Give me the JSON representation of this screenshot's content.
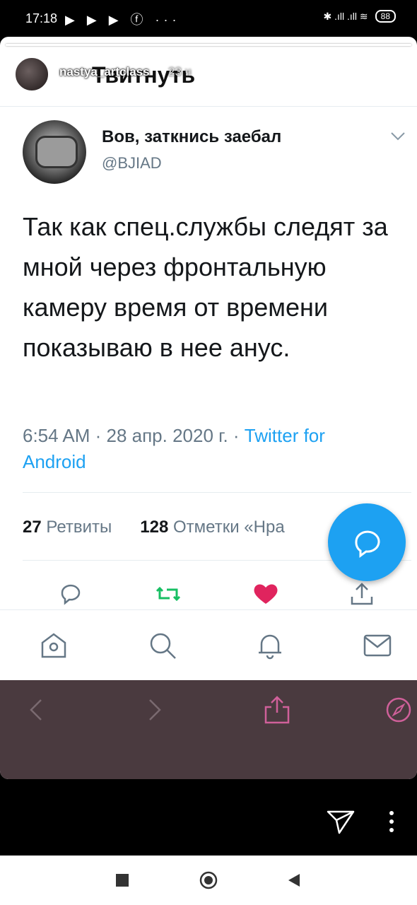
{
  "status_bar": {
    "time": "17:18",
    "left_icons": "▶ ▶ ▶ ⓕ ···",
    "signal": "✱ .ıll .ıll ≋",
    "battery": "88"
  },
  "story": {
    "username": "nastya_artclass",
    "time": "23 ч",
    "page_title": "Твитнуть"
  },
  "tweet": {
    "name": "Вов, заткнись заебал",
    "handle": "@BJIAD",
    "text": "Так как спец.службы следят за мной через фронтальную камеру время от времени показываю в нее анус.",
    "timestamp": "6:54 AM · 28 апр. 2020 г. · ",
    "client": "Twitter for Android",
    "retweets_count": "27",
    "retweets_label": "Ретвиты",
    "likes_count": "128",
    "likes_label": "Отметки «Нра"
  },
  "colors": {
    "twitter_blue": "#1da1f2",
    "retweet_green": "#17bf63",
    "like_red": "#e0245e",
    "browser_bar": "#4a3a3f",
    "browser_icon": "#d0609a"
  }
}
